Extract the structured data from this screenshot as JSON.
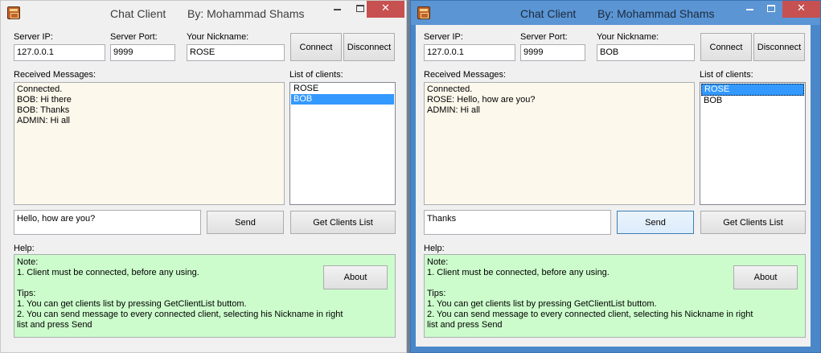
{
  "left": {
    "title_app": "Chat Client",
    "title_by": "By: Mohammad Shams",
    "server_ip_label": "Server IP:",
    "server_ip": "127.0.0.1",
    "server_port_label": "Server Port:",
    "server_port": "9999",
    "nickname_label": "Your Nickname:",
    "nickname": "ROSE",
    "connect_label": "Connect",
    "disconnect_label": "Disconnect",
    "received_label": "Received Messages:",
    "messages": [
      "Connected.",
      "BOB: Hi there",
      "BOB: Thanks",
      "ADMIN: Hi all"
    ],
    "clients_label": "List of clients:",
    "clients": [
      "ROSE",
      "BOB"
    ],
    "selected_client": "BOB",
    "message_input": "Hello, how are you?",
    "send_label": "Send",
    "get_clients_label": "Get Clients List",
    "help_label": "Help:",
    "about_label": "About"
  },
  "right": {
    "title_app": "Chat Client",
    "title_by": "By: Mohammad Shams",
    "server_ip_label": "Server IP:",
    "server_ip": "127.0.0.1",
    "server_port_label": "Server Port:",
    "server_port": "9999",
    "nickname_label": "Your Nickname:",
    "nickname": "BOB",
    "connect_label": "Connect",
    "disconnect_label": "Disconnect",
    "received_label": "Received Messages:",
    "messages": [
      "Connected.",
      "ROSE: Hello, how are you?",
      "ADMIN: Hi all"
    ],
    "clients_label": "List of clients:",
    "clients": [
      "ROSE",
      "BOB"
    ],
    "selected_client": "ROSE",
    "message_input": "Thanks",
    "send_label": "Send",
    "get_clients_label": "Get Clients List",
    "help_label": "Help:",
    "about_label": "About"
  },
  "help_lines": [
    "Note:",
    "1. Client  must be connected, before any using.",
    "",
    "Tips:",
    "1. You can get clients list by pressing GetClientList buttom.",
    "2. You can send message to every connected client, selecting his Nickname in right",
    "list and press Send"
  ],
  "colors": {
    "messages_bg": "#fdf8ec",
    "help_bg": "#ccfccc",
    "selection": "#3399ff",
    "active_frame": "#4a87c9",
    "close_button": "#c75050"
  }
}
